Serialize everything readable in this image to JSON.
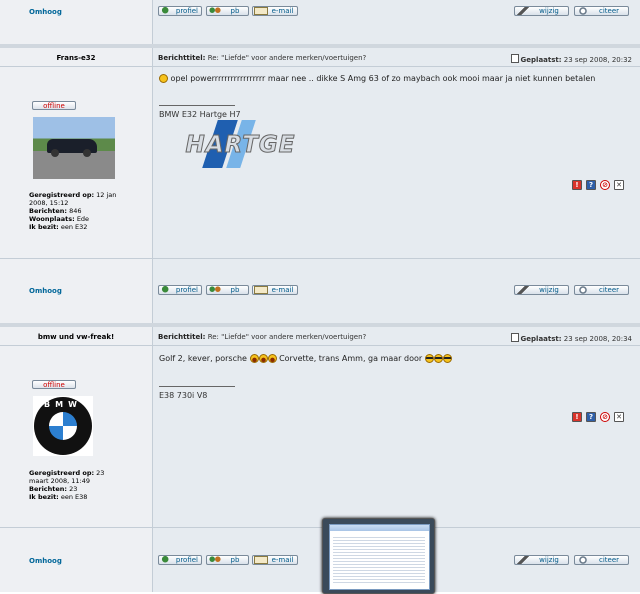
{
  "common": {
    "omhoog": "Omhoog",
    "profiel": "profiel",
    "pb": "pb",
    "email": "e-mail",
    "wijzig": "wijzig",
    "citeer": "citeer",
    "offline": "offline",
    "subject_label": "Berichttitel:",
    "posted_label": "Geplaatst:"
  },
  "posts": [
    {
      "author": "Frans-e32",
      "subject": "Re: \"Liefde\" voor andere merken/voertuigen?",
      "date": "23 sep 2008, 20:32",
      "reg_label": "Geregistreerd op:",
      "reg_value": "12 jan 2008, 15:12",
      "msgs_label": "Berichten:",
      "msgs_value": "846",
      "loc_label": "Woonplaats:",
      "loc_value": "Ede",
      "owns_label": "Ik bezit:",
      "owns_value": "een E32",
      "message": "opel powerrrrrrrrrrrrrrrrr maar nee .. dikke S Amg 63 of zo maybach ook mooi maar ja niet kunnen betalen",
      "signature": "BMW E32 Hartge H7",
      "logo_text": "HARTGE"
    },
    {
      "author": "bmw und vw-freak!",
      "subject": "Re: \"Liefde\" voor andere merken/voertuigen?",
      "date": "23 sep 2008, 20:34",
      "reg_label": "Geregistreerd op:",
      "reg_value": "23 maart 2008, 11:49",
      "msgs_label": "Berichten:",
      "msgs_value": "23",
      "owns_label": "Ik bezit:",
      "owns_value": "een E38",
      "message_a": "Golf 2, kever, porsche",
      "message_b": "Corvette, trans Amm, ga maar door",
      "signature": "E38 730i V8",
      "logo_text": "BMW"
    }
  ],
  "colors": {
    "link": "#006699",
    "offline": "#cc0000",
    "hartge_blue": "#1f5fb0",
    "hartge_light": "#78b4e8"
  }
}
